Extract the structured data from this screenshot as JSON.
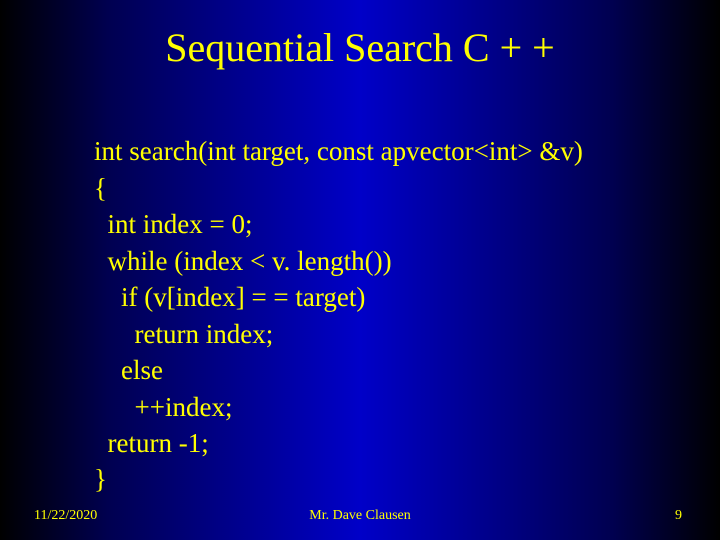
{
  "title": "Sequential Search C + +",
  "code": {
    "l0": "int search(int target, const apvector<int> &v)",
    "l1": "{",
    "l2": "  int index = 0;",
    "l3": "  while (index < v. length())",
    "l4": "    if (v[index] = = target)",
    "l5": "      return index;",
    "l6": "    else",
    "l7": "      ++index;",
    "l8": "  return -1;",
    "l9": "}"
  },
  "footer": {
    "date": "11/22/2020",
    "author": "Mr. Dave Clausen",
    "page": "9"
  }
}
